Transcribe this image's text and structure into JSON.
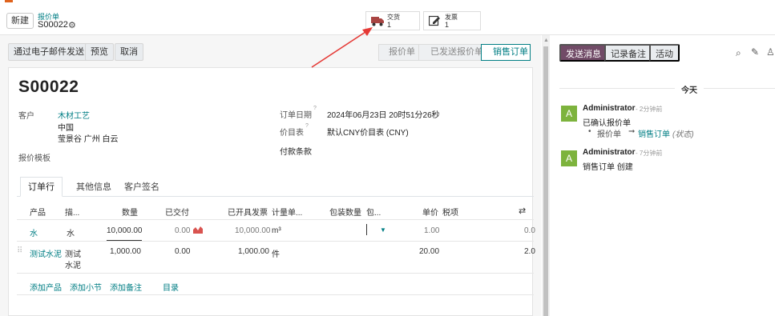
{
  "control_panel": {
    "new_button": "新建",
    "breadcrumb_parent": "报价单",
    "breadcrumb_current": "S00022"
  },
  "smart_buttons": [
    {
      "label": "交货",
      "count": "1",
      "icon": "truck-icon",
      "color": "#a94442"
    },
    {
      "label": "发票",
      "count": "1",
      "icon": "invoice-icon"
    }
  ],
  "toolbar": {
    "send_email": "通过电子邮件发送",
    "preview": "预览",
    "cancel": "取消"
  },
  "statusbar": {
    "steps": [
      "报价单",
      "已发送报价单",
      "销售订单"
    ],
    "active": "销售订单"
  },
  "form": {
    "name": "S00022",
    "customer_label": "客户",
    "customer_name": "木材工艺",
    "customer_address_1": "中国",
    "customer_address_2": "莹景谷 广州 白云",
    "template_label": "报价模板",
    "order_date_label": "订单日期",
    "order_date_help": "?",
    "order_date": "2024年06月23日 20时51分26秒",
    "pricelist_label": "价目表",
    "pricelist_help": "?",
    "pricelist": "默认CNY价目表 (CNY)",
    "payment_terms_label": "付款条款"
  },
  "tabs": [
    "订单行",
    "其他信息",
    "客户签名"
  ],
  "order_lines": {
    "headers": [
      "产品",
      "描...",
      "数量",
      "已交付",
      "已开具发票",
      "计量单...",
      "包装数量",
      "包...",
      "单价",
      "税项"
    ],
    "rows": [
      {
        "product": "水",
        "description": "水",
        "quantity": "10,000.00",
        "delivered": "0.00",
        "invoiced": "10,000.00",
        "uom": "m³",
        "unit_price": "1.00",
        "subtotal": "0.0"
      },
      {
        "product": "测试水泥",
        "description_1": "测试",
        "description_2": "水泥",
        "quantity": "1,000.00",
        "delivered": "0.00",
        "invoiced": "1,000.00",
        "uom": "件",
        "unit_price": "20.00",
        "subtotal": "2.0"
      }
    ],
    "add_product": "添加产品",
    "add_section": "添加小节",
    "add_note": "添加备注",
    "catalog": "目录"
  },
  "chatter": {
    "send_message": "发送消息",
    "log_note": "记录备注",
    "activities": "活动",
    "date_separator": "今天",
    "messages": [
      {
        "avatar": "A",
        "author": "Administrator",
        "time": "- 2分钟前",
        "body": "已确认报价单",
        "tracking_old": "报价单",
        "tracking_new": "销售订单",
        "tracking_field": "(状态)"
      },
      {
        "avatar": "A",
        "author": "Administrator",
        "time": "- 7分钟前",
        "body": "销售订单 创建"
      }
    ]
  },
  "colors": {
    "brand": "#714b67",
    "link": "#017e84",
    "avatar": "#7db33d",
    "annotation_arrow": "#e53935"
  }
}
